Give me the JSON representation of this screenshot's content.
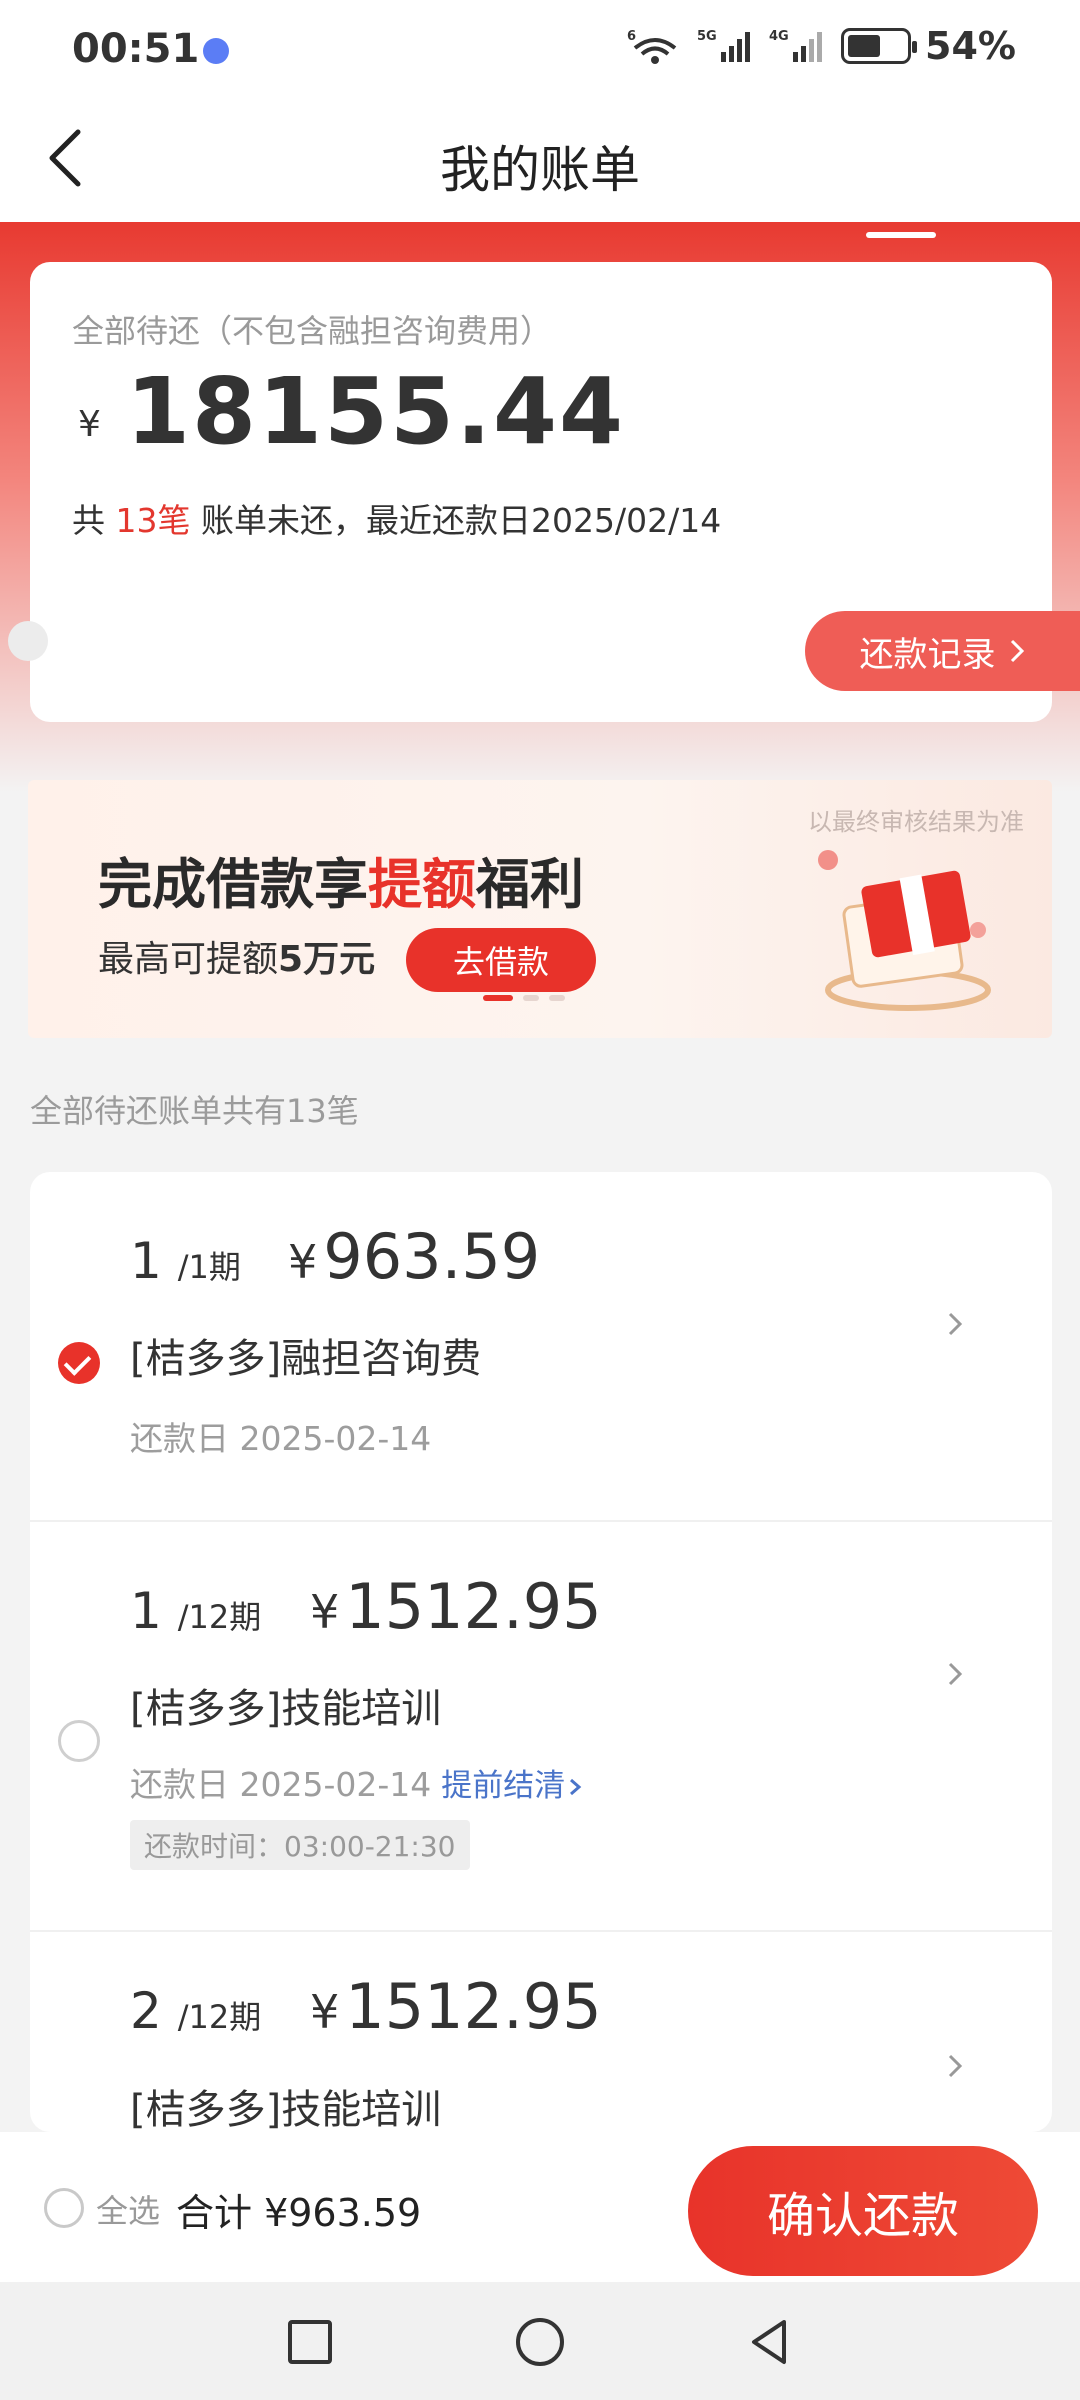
{
  "status_bar": {
    "time": "00:51",
    "signal_labels": [
      "6",
      "5G",
      "4G"
    ],
    "battery": "54%"
  },
  "nav": {
    "title": "我的账单"
  },
  "summary": {
    "subtitle": "全部待还（不包含融担咨询费用）",
    "currency": "¥",
    "total": "18155.44",
    "info_prefix": "共 ",
    "count": "13笔",
    "info_suffix": " 账单未还，最近还款日2025/02/14",
    "record_button": "还款记录"
  },
  "banner": {
    "note": "以最终审核结果为准",
    "title_part1": "完成借款享",
    "title_highlight": "提额",
    "title_part2": "福利",
    "sub_prefix": "最高可提额",
    "sub_bold": "5万元",
    "button": "去借款"
  },
  "list_caption": "全部待还账单共有13笔",
  "bills": [
    {
      "period": "1",
      "period_total": "/1期",
      "currency": "¥",
      "amount": "963.59",
      "name": "[桔多多]融担咨询费",
      "date": "还款日 2025-02-14",
      "checked": true
    },
    {
      "period": "1",
      "period_total": "/12期",
      "currency": "¥",
      "amount": "1512.95",
      "name": "[桔多多]技能培训",
      "date": "还款日 2025-02-14",
      "early_payoff": "提前结清",
      "pay_time": "还款时间：03:00-21:30",
      "checked": false
    },
    {
      "period": "2",
      "period_total": "/12期",
      "currency": "¥",
      "amount": "1512.95",
      "name": "[桔多多]技能培训",
      "checked": false
    }
  ],
  "bottom_bar": {
    "select_all": "全选",
    "total_label": "合计 ¥963.59",
    "confirm_button": "确认还款"
  },
  "colors": {
    "accent": "#e8322a",
    "link": "#4a74c9"
  }
}
